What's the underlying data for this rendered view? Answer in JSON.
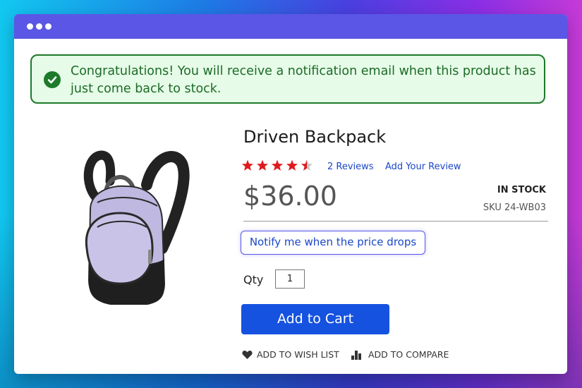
{
  "alert": {
    "icon": "check-circle-icon",
    "message": "Congratulations! You will receive a notification email when this product has just come back to stock."
  },
  "product": {
    "image": "backpack-image",
    "name": "Driven Backpack",
    "rating": 4.5,
    "rating_max": 5,
    "reviews_label": "2 Reviews",
    "add_review_label": "Add Your Review",
    "price": "$36.00",
    "stock_status": "IN STOCK",
    "sku": "SKU 24-WB03"
  },
  "actions": {
    "notify_price_drop": "Notify me when the price drops",
    "qty_label": "Qty",
    "qty_value": "1",
    "add_to_cart": "Add to Cart",
    "wish_list": "ADD TO WISH LIST",
    "compare": "ADD TO COMPARE",
    "wish_icon": "heart-icon",
    "compare_icon": "bar-chart-icon"
  },
  "colors": {
    "accent": "#1652e0",
    "alert_green": "#1d7a2a",
    "star_red": "#e0191e",
    "titlebar": "#5b56e6"
  }
}
